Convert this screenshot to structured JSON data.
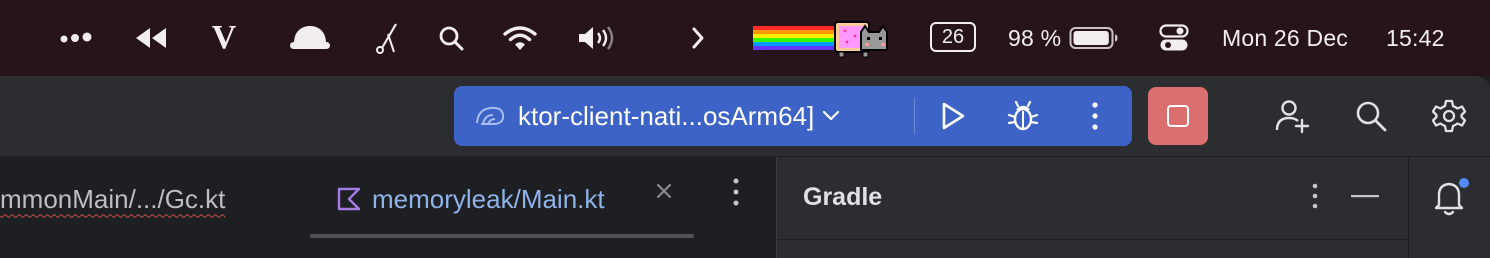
{
  "menubar": {
    "icons": [
      "dots-icon",
      "rewind-icon",
      "vivaldi-v-icon",
      "cloud-hat-icon",
      "scissors-pen-icon",
      "search-icon",
      "wifi-icon",
      "volume-icon",
      "chevron-right-icon",
      "nyan-cat-icon",
      "calendar-badge-icon",
      "battery-icon",
      "control-center-icon"
    ],
    "app_glyph": "V",
    "calendar_day": "26",
    "battery_percent": "98 %",
    "battery_level": 0.98,
    "date": "Mon 26 Dec",
    "time": "15:42"
  },
  "toolbar": {
    "run_config_label": "ktor-client-nati...osArm64]",
    "run_widget_color": "#3d63c6",
    "stop_button_color": "#db6f6f",
    "icons": [
      "run-config-icon",
      "chevron-down-icon",
      "play-icon",
      "bug-icon",
      "more-vertical-icon",
      "stop-icon",
      "add-user-icon",
      "search-icon",
      "gear-icon"
    ]
  },
  "editor": {
    "tabs": [
      {
        "label": "mmonMain/.../Gc.kt",
        "active": false,
        "has_error": true
      },
      {
        "label": "memoryleak/Main.kt",
        "active": true,
        "icon": "kotlin-file-icon"
      }
    ]
  },
  "gradle_panel": {
    "title": "Gradle"
  },
  "notifications": {
    "has_unread": true,
    "dot_color": "#548af7"
  }
}
